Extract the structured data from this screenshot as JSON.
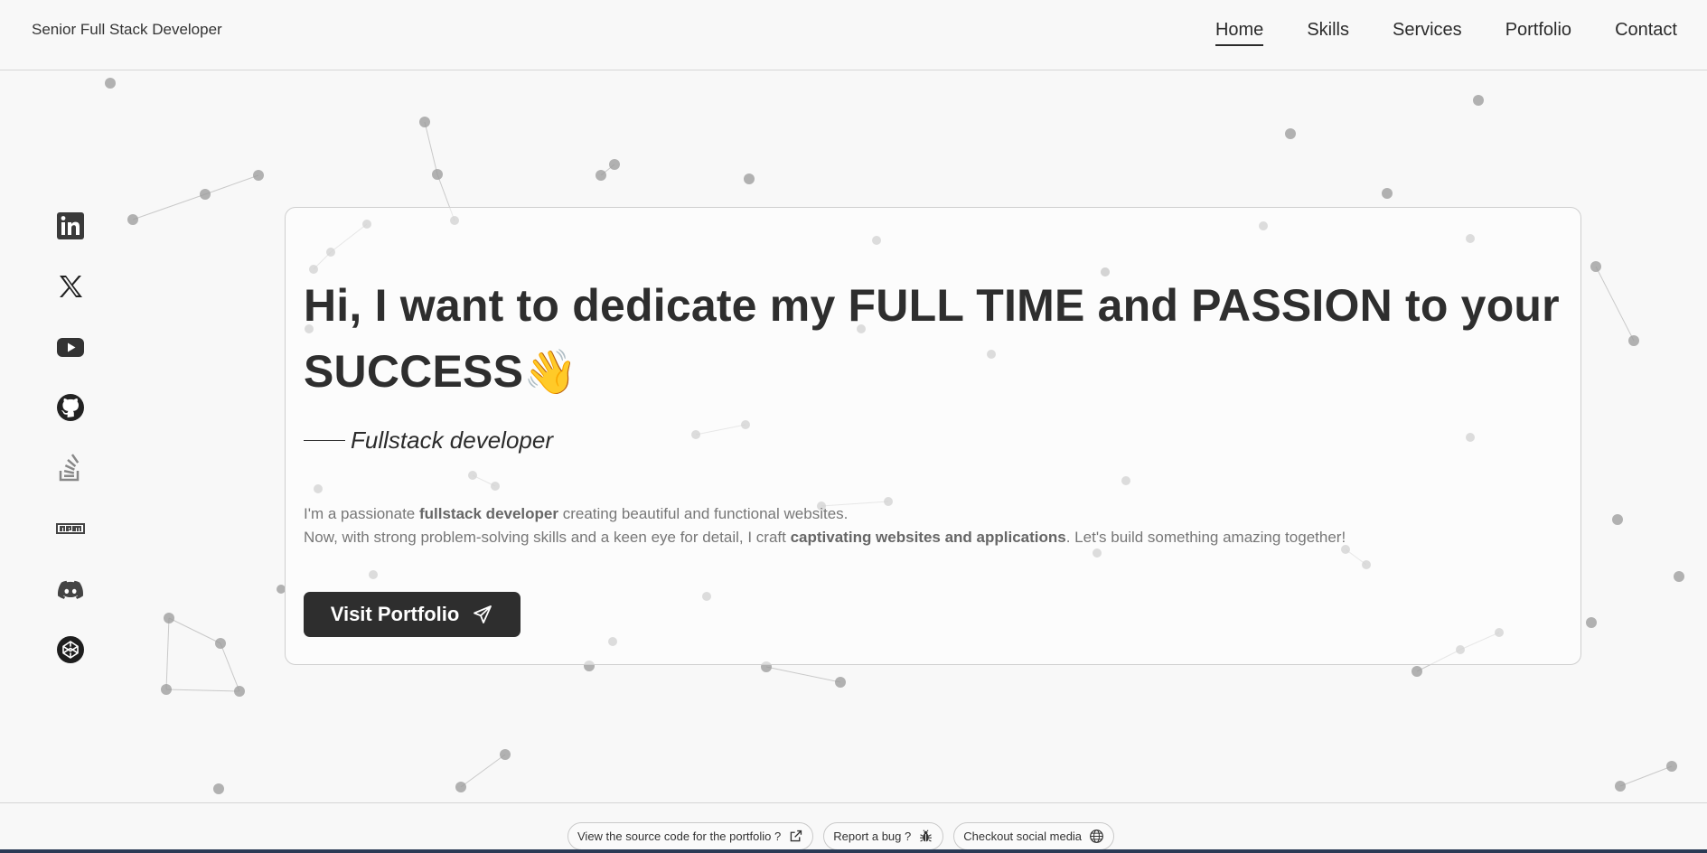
{
  "header": {
    "brand": "Senior Full Stack Developer",
    "nav": [
      {
        "label": "Home",
        "active": true
      },
      {
        "label": "Skills",
        "active": false
      },
      {
        "label": "Services",
        "active": false
      },
      {
        "label": "Portfolio",
        "active": false
      },
      {
        "label": "Contact",
        "active": false
      }
    ]
  },
  "social": [
    {
      "icon": "linkedin-icon"
    },
    {
      "icon": "x-twitter-icon"
    },
    {
      "icon": "youtube-icon"
    },
    {
      "icon": "github-icon"
    },
    {
      "icon": "stackoverflow-icon"
    },
    {
      "icon": "npm-icon"
    },
    {
      "icon": "discord-icon"
    },
    {
      "icon": "codepen-icon"
    }
  ],
  "hero": {
    "headline": "Hi, I want to dedicate my FULL TIME and PASSION to your SUCCESS",
    "wave_emoji": "👋",
    "subtitle": "Fullstack developer",
    "desc_line1_a": "I'm a passionate ",
    "desc_line1_b": "fullstack developer",
    "desc_line1_c": " creating beautiful and functional websites.",
    "desc_line2_a": "Now, with strong problem-solving skills and a keen eye for detail, I craft ",
    "desc_line2_b": "captivating websites and applications",
    "desc_line2_c": ". Let's build something amazing together!",
    "cta_label": "Visit Portfolio"
  },
  "footer": {
    "source_label": "View the source code for the portfolio ?",
    "bug_label": "Report a bug ?",
    "social_label": "Checkout social media"
  },
  "colors": {
    "background": "#f8f8f8",
    "text": "#2b2b2b",
    "button": "#2e2e2e",
    "accent_bar": "#2a3a55"
  }
}
